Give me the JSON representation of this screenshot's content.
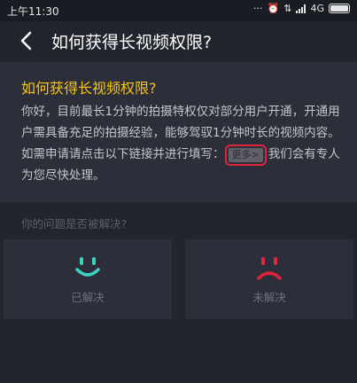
{
  "status_bar": {
    "time": "上午11:30",
    "network": "4G"
  },
  "nav": {
    "title": "如何获得长视频权限?"
  },
  "faq": {
    "question": "如何获得长视频权限?",
    "answer_part1": "你好，目前最长1分钟的拍摄特权仅对部分用户开通，开通用户需具备充足的拍摄经验，能够驾驭1分钟时长的视频内容。如需申请请点击以下链接并进行填写：",
    "more_link": "更多>",
    "answer_part2": "我们会有专人为您尽快处理。"
  },
  "feedback": {
    "prompt": "你的问题是否被解决?",
    "resolved_label": "已解决",
    "unresolved_label": "未解决"
  },
  "colors": {
    "accent_yellow": "#f5c518",
    "resolved_teal": "#3fd1c6",
    "unresolved_red": "#e0243a",
    "background": "#22242e",
    "card": "#2c2e3a"
  }
}
